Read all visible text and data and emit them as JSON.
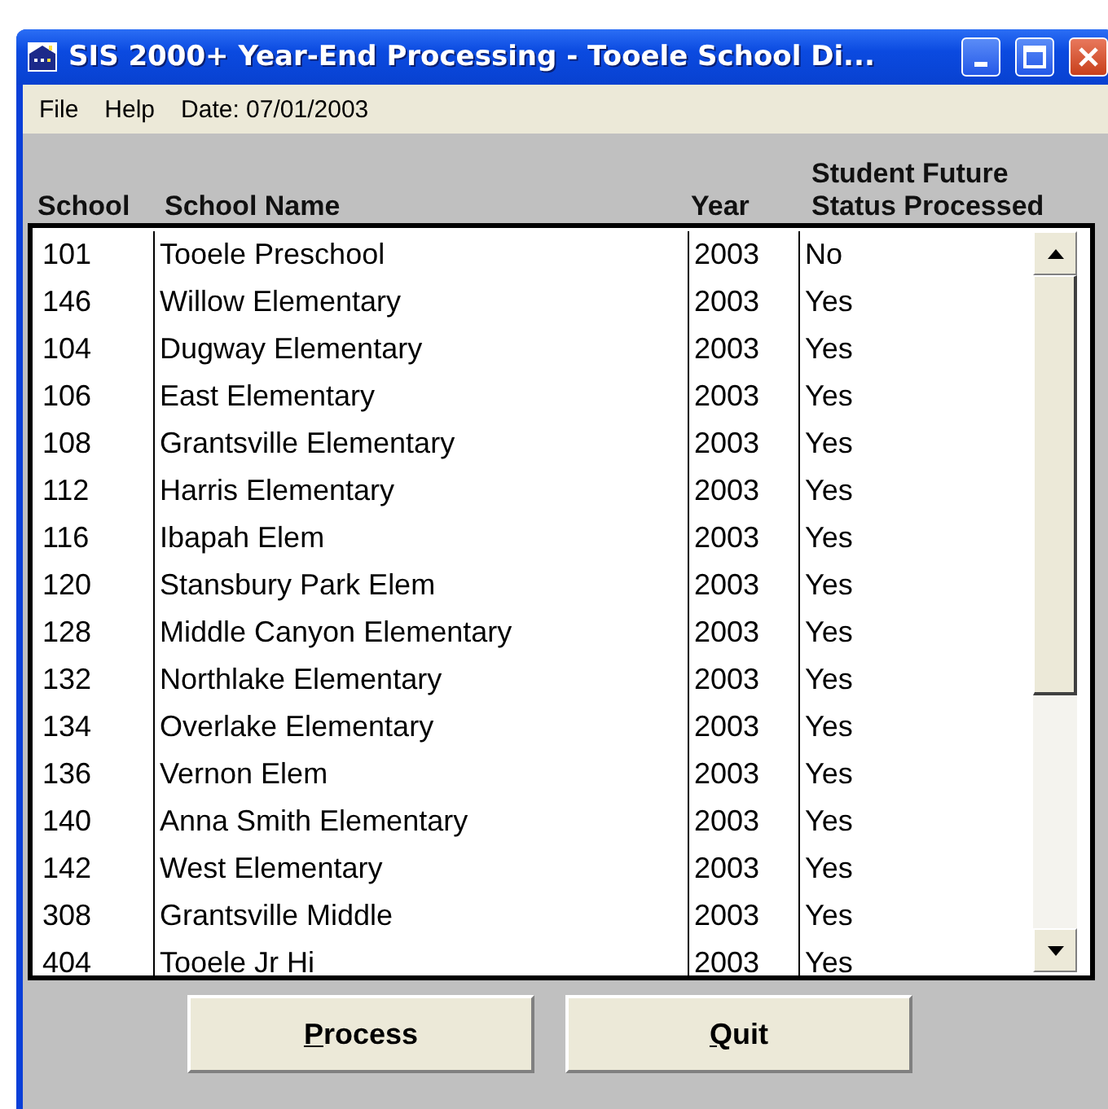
{
  "window": {
    "title": "SIS 2000+ Year-End Processing - Tooele School Di..."
  },
  "menu": [
    "File",
    "Help"
  ],
  "date_label": "Date: 07/01/2003",
  "table": {
    "columns": [
      {
        "label": "School"
      },
      {
        "label": "School Name"
      },
      {
        "label": "Year"
      },
      {
        "label": "Student Future Status Processed"
      }
    ],
    "rows": [
      [
        "101",
        "Tooele Preschool",
        "2003",
        "No"
      ],
      [
        "146",
        "Willow Elementary",
        "2003",
        "Yes"
      ],
      [
        "104",
        "Dugway Elementary",
        "2003",
        "Yes"
      ],
      [
        "106",
        "East Elementary",
        "2003",
        "Yes"
      ],
      [
        "108",
        "Grantsville Elementary",
        "2003",
        "Yes"
      ],
      [
        "112",
        "Harris Elementary",
        "2003",
        "Yes"
      ],
      [
        "116",
        "Ibapah Elem",
        "2003",
        "Yes"
      ],
      [
        "120",
        "Stansbury Park Elem",
        "2003",
        "Yes"
      ],
      [
        "128",
        "Middle Canyon Elementary",
        "2003",
        "Yes"
      ],
      [
        "132",
        "Northlake Elementary",
        "2003",
        "Yes"
      ],
      [
        "134",
        "Overlake Elementary",
        "2003",
        "Yes"
      ],
      [
        "136",
        "Vernon Elem",
        "2003",
        "Yes"
      ],
      [
        "140",
        "Anna Smith Elementary",
        "2003",
        "Yes"
      ],
      [
        "142",
        "West Elementary",
        "2003",
        "Yes"
      ],
      [
        "308",
        "Grantsville Middle",
        "2003",
        "Yes"
      ],
      [
        "404",
        "Tooele Jr Hi",
        "2003",
        "Yes"
      ]
    ]
  },
  "buttons": [
    "Process",
    "Quit"
  ]
}
